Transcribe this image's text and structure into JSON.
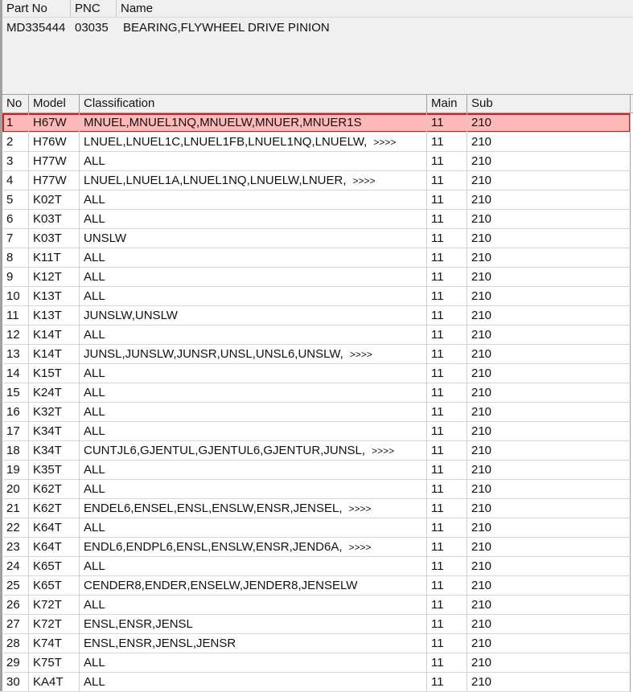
{
  "part": {
    "headers": [
      "Part No",
      "PNC",
      "Name"
    ],
    "part_no": "MD335444",
    "pnc": "03035",
    "name": "BEARING,FLYWHEEL DRIVE PINION"
  },
  "grid": {
    "headers": [
      "No",
      "Model",
      "Classification",
      "Main",
      "Sub"
    ],
    "more_marker": ">>>>",
    "selected_row": 1,
    "rows": [
      [
        "1",
        "H67W",
        "MNUEL,MNUEL1NQ,MNUELW,MNUER,MNUER1S",
        "11",
        "210",
        false
      ],
      [
        "2",
        "H76W",
        "LNUEL,LNUEL1C,LNUEL1FB,LNUEL1NQ,LNUELW,",
        "11",
        "210",
        true
      ],
      [
        "3",
        "H77W",
        "ALL",
        "11",
        "210",
        false
      ],
      [
        "4",
        "H77W",
        "LNUEL,LNUEL1A,LNUEL1NQ,LNUELW,LNUER,",
        "11",
        "210",
        true
      ],
      [
        "5",
        "K02T",
        "ALL",
        "11",
        "210",
        false
      ],
      [
        "6",
        "K03T",
        "ALL",
        "11",
        "210",
        false
      ],
      [
        "7",
        "K03T",
        "UNSLW",
        "11",
        "210",
        false
      ],
      [
        "8",
        "K11T",
        "ALL",
        "11",
        "210",
        false
      ],
      [
        "9",
        "K12T",
        "ALL",
        "11",
        "210",
        false
      ],
      [
        "10",
        "K13T",
        "ALL",
        "11",
        "210",
        false
      ],
      [
        "11",
        "K13T",
        "JUNSLW,UNSLW",
        "11",
        "210",
        false
      ],
      [
        "12",
        "K14T",
        "ALL",
        "11",
        "210",
        false
      ],
      [
        "13",
        "K14T",
        "JUNSL,JUNSLW,JUNSR,UNSL,UNSL6,UNSLW,",
        "11",
        "210",
        true
      ],
      [
        "14",
        "K15T",
        "ALL",
        "11",
        "210",
        false
      ],
      [
        "15",
        "K24T",
        "ALL",
        "11",
        "210",
        false
      ],
      [
        "16",
        "K32T",
        "ALL",
        "11",
        "210",
        false
      ],
      [
        "17",
        "K34T",
        "ALL",
        "11",
        "210",
        false
      ],
      [
        "18",
        "K34T",
        "CUNTJL6,GJENTUL,GJENTUL6,GJENTUR,JUNSL,",
        "11",
        "210",
        true
      ],
      [
        "19",
        "K35T",
        "ALL",
        "11",
        "210",
        false
      ],
      [
        "20",
        "K62T",
        "ALL",
        "11",
        "210",
        false
      ],
      [
        "21",
        "K62T",
        "ENDEL6,ENSEL,ENSL,ENSLW,ENSR,JENSEL,",
        "11",
        "210",
        true
      ],
      [
        "22",
        "K64T",
        "ALL",
        "11",
        "210",
        false
      ],
      [
        "23",
        "K64T",
        "ENDL6,ENDPL6,ENSL,ENSLW,ENSR,JEND6A,",
        "11",
        "210",
        true
      ],
      [
        "24",
        "K65T",
        "ALL",
        "11",
        "210",
        false
      ],
      [
        "25",
        "K65T",
        "CENDER8,ENDER,ENSELW,JENDER8,JENSELW",
        "11",
        "210",
        false
      ],
      [
        "26",
        "K72T",
        "ALL",
        "11",
        "210",
        false
      ],
      [
        "27",
        "K72T",
        "ENSL,ENSR,JENSL",
        "11",
        "210",
        false
      ],
      [
        "28",
        "K74T",
        "ENSL,ENSR,JENSL,JENSR",
        "11",
        "210",
        false
      ],
      [
        "29",
        "K75T",
        "ALL",
        "11",
        "210",
        false
      ],
      [
        "30",
        "KA4T",
        "ALL",
        "11",
        "210",
        false
      ]
    ]
  }
}
